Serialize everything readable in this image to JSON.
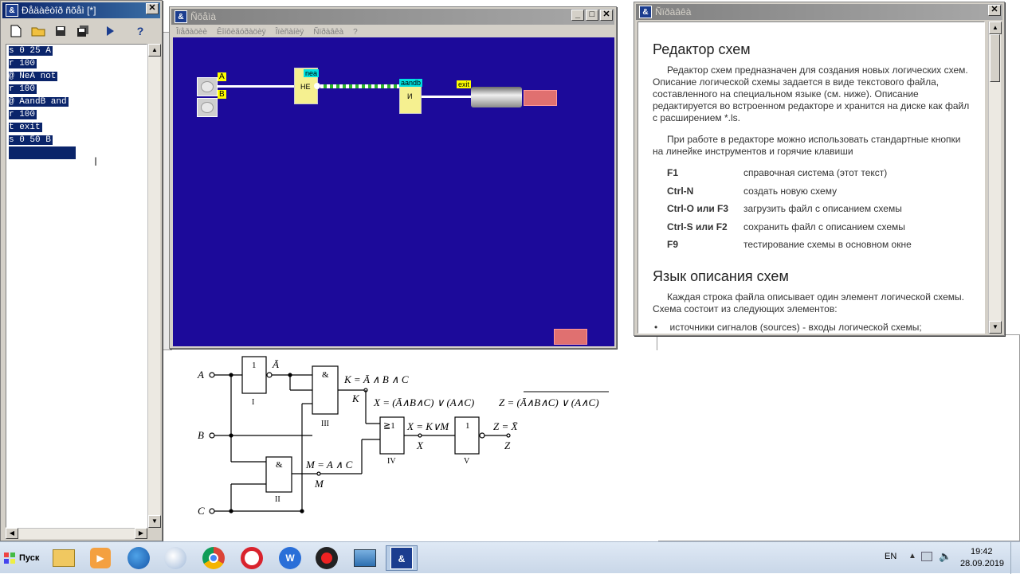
{
  "editor": {
    "title": "Ðåäàêòîð ñõåì [*]",
    "toolbar_icons": [
      "new-file-icon",
      "open-folder-icon",
      "save-icon",
      "save-all-icon",
      "run-icon",
      "help-icon"
    ],
    "help_glyph": "?",
    "code_lines": [
      "s 0 25 A",
      "r 100",
      "@ NeA not",
      "r 100",
      "@ AandB and",
      "r 100",
      "t exit",
      "s 0 50 B",
      ""
    ]
  },
  "schematic": {
    "title": "Ñõåìà",
    "menu": [
      "Îïåðàöèè",
      "Êîíôèãóðàöèÿ",
      "Îïèñàíèÿ",
      "Ñïðàâêà",
      "?"
    ],
    "label_a": "A",
    "label_b": "B",
    "label_nea": "nea",
    "label_not": "НЕ",
    "label_aandb": "aandb",
    "label_and": "И",
    "label_exit": "exit",
    "bg_color": "#1c0a9a"
  },
  "help": {
    "title": "Ñïðàâêà",
    "heading1": "Редактор схем",
    "para1": "Редактор схем предназначен для создания новых логических схем. Описание логической схемы задается в виде текстового файла, составленного на специальном языке (см. ниже). Описание редактируется во встроенном редакторе и хранится на диске как файл с расширением *.ls.",
    "para2": "При работе в редакторе можно использовать стандартные кнопки на линейке инструментов и горячие клавиши",
    "shortcuts": [
      {
        "key": "F1",
        "desc": "справочная система (этот текст)"
      },
      {
        "key": "Ctrl-N",
        "desc": "создать новую схему"
      },
      {
        "key": "Ctrl-O или F3",
        "desc": "загрузить файл с описанием схемы"
      },
      {
        "key": "Ctrl-S или F2",
        "desc": "сохранить файл с описанием схемы"
      },
      {
        "key": "F9",
        "desc": "тестирование схемы в основном окне"
      }
    ],
    "heading2": "Язык описания схем",
    "para3": "Каждая строка файла описывает один элемент логической схемы. Схема состоит из следующих элементов:",
    "bullet": "источники сигналов (sources) - входы логической схемы;"
  },
  "diagram": {
    "in_a": "A",
    "in_b": "B",
    "in_c": "C",
    "g1": "1",
    "g2": "&",
    "g3": "&",
    "g4": "≧1",
    "g5": "1",
    "r1": "I",
    "r2": "II",
    "r3": "III",
    "r4": "IV",
    "r5": "V",
    "nota": "Ā",
    "k_expr": "K = Ā ∧ B ∧ C",
    "k": "K",
    "x_expr": "X = (Ā∧B∧C) ∨ (A∧C)",
    "z_expr": "Z = (Ā∧B∧C) ∨ (A∧C)",
    "m_expr": "M = A ∧ C",
    "m": "M",
    "x_or": "X = K∨M",
    "x": "X",
    "z_not": "Z = X̄",
    "z": "Z"
  },
  "taskbar": {
    "start": "Пуск",
    "lang": "EN",
    "time": "19:42",
    "date": "28.09.2019"
  }
}
